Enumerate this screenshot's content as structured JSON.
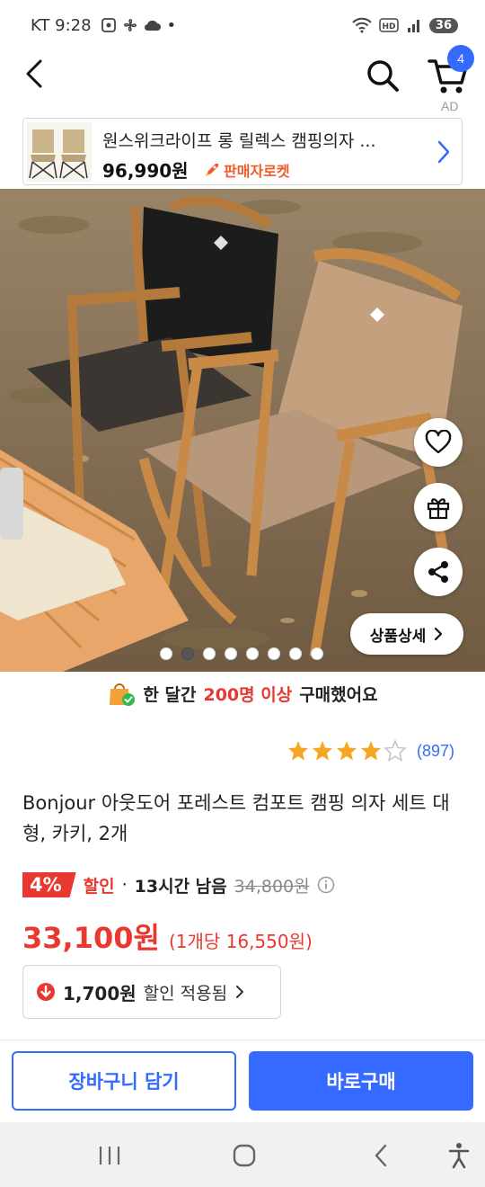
{
  "status_bar": {
    "carrier_time": "KT 9:28",
    "battery": "36",
    "dot": "•"
  },
  "nav": {
    "cart_count": "4",
    "ad_label": "AD"
  },
  "ad_banner": {
    "title": "원스위크라이프 롱 릴렉스 캠핑의자 ...",
    "price": "96,990원",
    "delivery": "판매자로켓"
  },
  "hero": {
    "detail_button": "상품상세",
    "slide_count": 8,
    "active_slide": 1
  },
  "purchase": {
    "prefix": "한 달간",
    "highlight": "200명 이상",
    "suffix": "구매했어요"
  },
  "rating": {
    "stars": 4.5,
    "count": "(897)"
  },
  "product": {
    "name": "Bonjour 아웃도어 포레스트 컴포트 캠핑 의자 세트 대형, 카키, 2개"
  },
  "discount": {
    "percent": "4%",
    "label": "할인",
    "separator": "·",
    "time_left": "13시간 남음",
    "original_price": "34,800원"
  },
  "price": {
    "sale": "33,100원",
    "unit": "(1개당 16,550원)"
  },
  "coupon": {
    "amount": "1,700원",
    "text": "할인 적용됨"
  },
  "actions": {
    "cart": "장바구니 담기",
    "buy": "바로구매"
  },
  "colors": {
    "accent_blue": "#346aff",
    "sale_red": "#e8382f",
    "rocket_orange": "#f05a28"
  }
}
